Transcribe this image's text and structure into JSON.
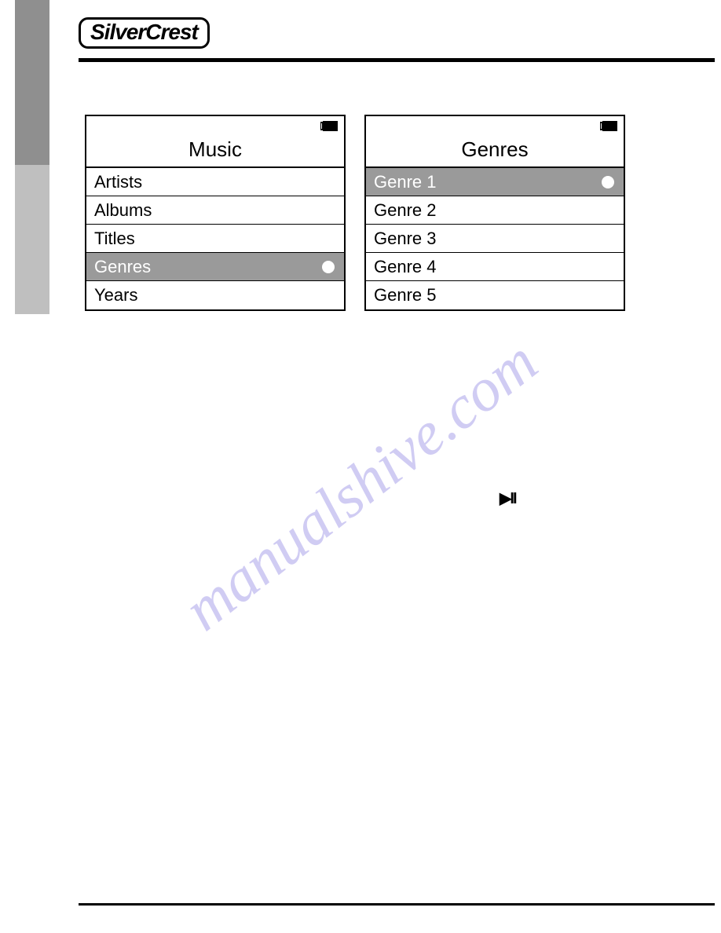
{
  "brand": "SilverCrest",
  "watermark": "manualshive.com",
  "play_pause_icon": "▶II",
  "screen_left": {
    "title": "Music",
    "items": [
      {
        "label": "Artists",
        "selected": false
      },
      {
        "label": "Albums",
        "selected": false
      },
      {
        "label": "Titles",
        "selected": false
      },
      {
        "label": "Genres",
        "selected": true
      },
      {
        "label": "Years",
        "selected": false
      }
    ]
  },
  "screen_right": {
    "title": "Genres",
    "items": [
      {
        "label": "Genre 1",
        "selected": true
      },
      {
        "label": "Genre 2",
        "selected": false
      },
      {
        "label": "Genre 3",
        "selected": false
      },
      {
        "label": "Genre 4",
        "selected": false
      },
      {
        "label": "Genre 5",
        "selected": false
      }
    ]
  }
}
